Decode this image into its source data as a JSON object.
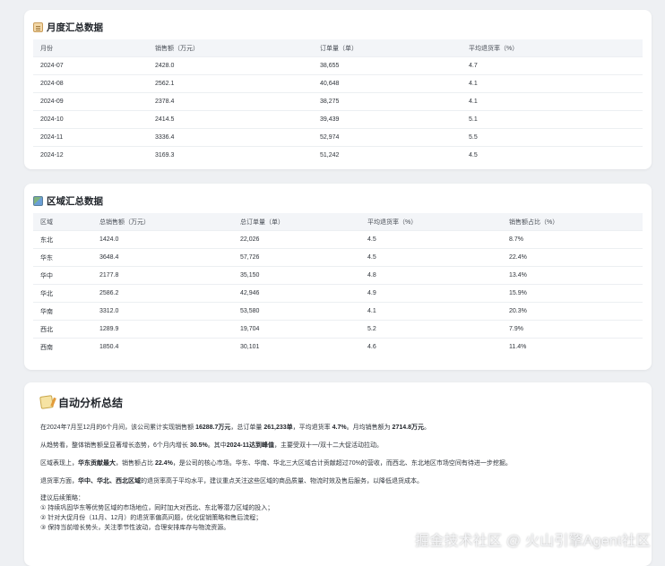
{
  "monthly": {
    "title": "月度汇总数据",
    "columns": [
      "月份",
      "销售额（万元）",
      "订单量（单）",
      "平均退货率（%）"
    ],
    "rows": [
      [
        "2024-07",
        "2428.0",
        "38,655",
        "4.7"
      ],
      [
        "2024-08",
        "2562.1",
        "40,648",
        "4.1"
      ],
      [
        "2024-09",
        "2378.4",
        "38,275",
        "4.1"
      ],
      [
        "2024-10",
        "2414.5",
        "39,439",
        "5.1"
      ],
      [
        "2024-11",
        "3336.4",
        "52,974",
        "5.5"
      ],
      [
        "2024-12",
        "3169.3",
        "51,242",
        "4.5"
      ]
    ]
  },
  "regional": {
    "title": "区域汇总数据",
    "columns": [
      "区域",
      "总销售额（万元）",
      "总订单量（单）",
      "平均退货率（%）",
      "销售额占比（%）"
    ],
    "rows": [
      [
        "东北",
        "1424.0",
        "22,026",
        "4.5",
        "8.7%"
      ],
      [
        "华东",
        "3648.4",
        "57,726",
        "4.5",
        "22.4%"
      ],
      [
        "华中",
        "2177.8",
        "35,150",
        "4.8",
        "13.4%"
      ],
      [
        "华北",
        "2586.2",
        "42,946",
        "4.9",
        "15.9%"
      ],
      [
        "华南",
        "3312.0",
        "53,580",
        "4.1",
        "20.3%"
      ],
      [
        "西北",
        "1289.9",
        "19,704",
        "5.2",
        "7.9%"
      ],
      [
        "西南",
        "1850.4",
        "30,101",
        "4.6",
        "11.4%"
      ]
    ]
  },
  "analysis": {
    "title": "自动分析总结",
    "p1": {
      "t1": "在2024年7月至12月的6个月间，该公司累计实现销售额 ",
      "b1": "16288.7万元",
      "t2": "，总订单量 ",
      "b2": "261,233单",
      "t3": "，平均退货率 ",
      "b3": "4.7%",
      "t4": "。月均销售额为 ",
      "b4": "2714.8万元",
      "t5": "。"
    },
    "p2": {
      "t1": "从趋势看，整体销售额呈显著增长态势，6个月内增长 ",
      "b1": "30.5%",
      "t2": "。其中",
      "b2": "2024-11达到峰值",
      "t3": "，主要受双十一/双十二大促活动拉动。"
    },
    "p3": {
      "t1": "区域表现上，",
      "b1": "华东贡献最大",
      "t2": "，销售额占比 ",
      "b2": "22.4%",
      "t3": "，是公司的核心市场。华东、华南、华北三大区域合计贡献超过70%的营收，而西北、东北地区市场空间有待进一步挖掘。"
    },
    "p4": {
      "t1": "退货率方面，",
      "b1": "华中、华北、西北区域",
      "t2": "的退货率高于平均水平，建议重点关注这些区域的商品质量、物流时效及售后服务，以降低退货成本。"
    },
    "suggest_title": "建议后续策略：",
    "suggestions": [
      "① 持续巩固华东等优势区域的市场地位，同时加大对西北、东北等潜力区域的投入；",
      "② 针对大促月份（11月、12月）的退货率偏高问题，优化促销策略和售后流程；",
      "③ 保持当前增长势头，关注季节性波动，合理安排库存与物流资源。"
    ]
  },
  "watermark": "掘金技术社区 @ 火山引擎Agent社区"
}
